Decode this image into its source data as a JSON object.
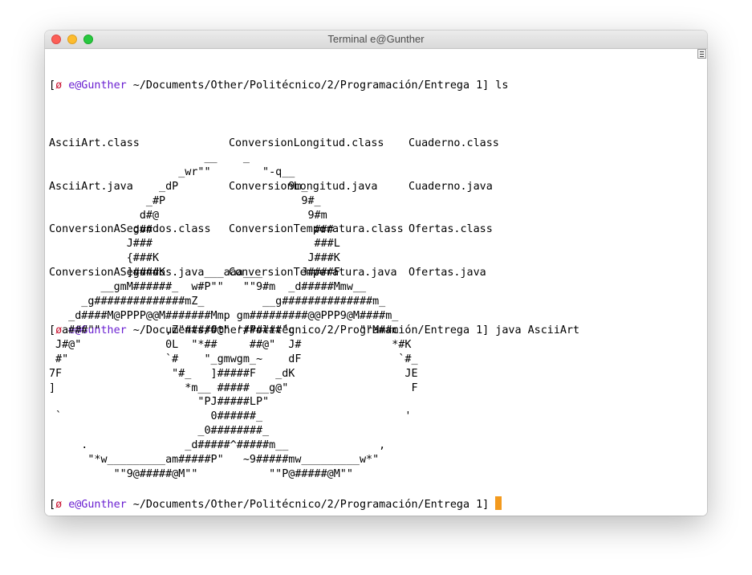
{
  "window": {
    "title": "Terminal e@Gunther"
  },
  "prompt": {
    "open": "[",
    "symbol": "ø",
    "user": "e@Gunther",
    "path": " ~/Documents/Other/Politécnico/2/Programación/Entrega 1]",
    "close": ""
  },
  "commands": {
    "first": " ls",
    "second": " java AsciiArt",
    "third": " "
  },
  "ls_output": [
    [
      "AsciiArt.class",
      "ConversionLongitud.class",
      "Cuaderno.class"
    ],
    [
      "AsciiArt.java",
      "ConversionLongitud.java",
      "Cuaderno.java"
    ],
    [
      "ConversionASegundos.class",
      "ConversionTemperatura.class",
      "Ofertas.class"
    ],
    [
      "ConversionASegundos.java",
      "ConversionTemperatura.java",
      "Ofertas.java"
    ]
  ],
  "ascii_art": "                        __    _\n                    _wr\"\"        \"-q__\n                 _dP                 9m_\n               _#P                     9#_\n              d#@                       9#m\n             d##                         ###\n            J###                         ###L\n            {###K                       J###K\n            ]####K      ___aaa___      J####F\n        __gmM######_  w#P\"\"   \"\"9#m  _d#####Mmw__\n     _g##############mZ_         __g##############m_\n   _d####M@PPPP@@M#######Mmp gm#########@@PPP9@M####m_\n  a###\"\"          ,Z\"#####@\" '######\"g          \"\"M##m\n J#@\"             0L  \"*##     ##@\"  J#              *#K\n #\"               `#    \"_gmwgm_~    dF               `#_\n7F                 \"#_   ]#####F   _dK                 JE\n]                    *m__ ##### __g@\"                   F\n                       \"PJ#####LP\"\n `                       0######_                      '\n                       _0########_\n     .               _d#####^#####m__              ,\n      \"*w_________am#####P\"   ~9#####mw_________w*\"\n          \"\"9@#####@M\"\"           \"\"P@#####@M\"\"",
  "colors": {
    "prompt_symbol": "#c8102e",
    "prompt_user": "#6a1fd1",
    "cursor": "#f39a1e",
    "close_button": "#fc5f57",
    "minimize_button": "#fdbc2e",
    "maximize_button": "#28c840"
  },
  "icons": {
    "close": "close-icon",
    "minimize": "minimize-icon",
    "maximize": "maximize-icon",
    "menu": "menu-icon"
  }
}
